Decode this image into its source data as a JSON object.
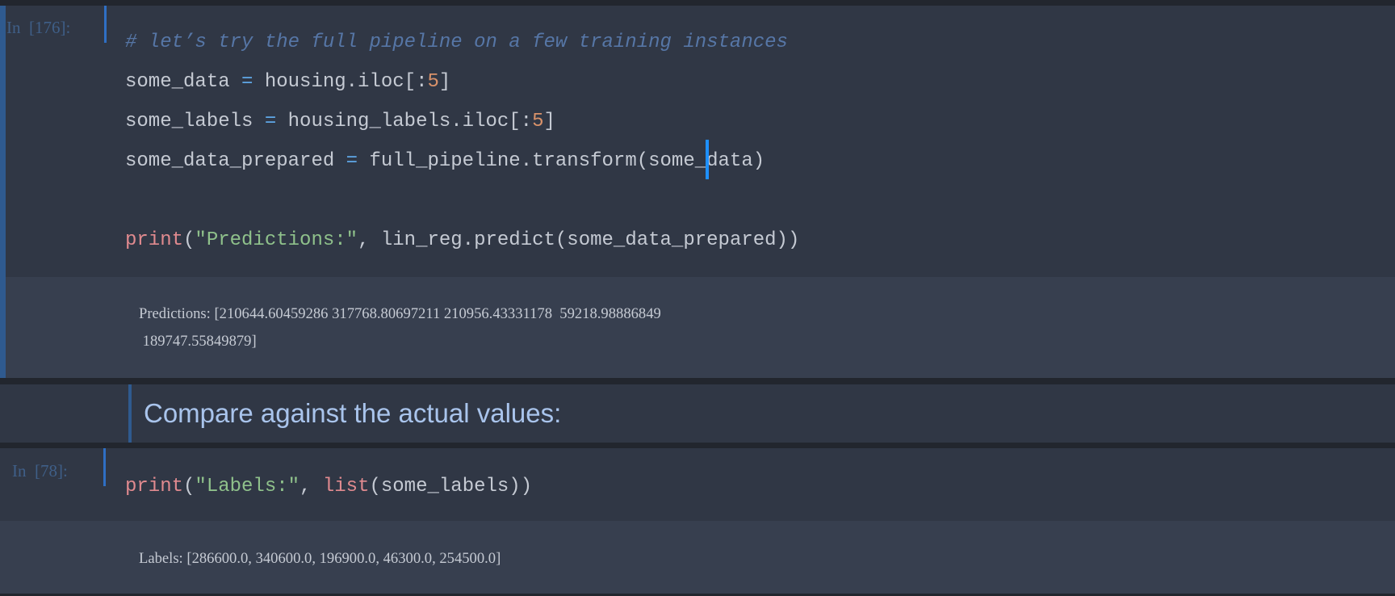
{
  "colors": {
    "accent": "#2f6fc4",
    "selected_bar": "#2f5a8f",
    "cursor": "#1e90ff"
  },
  "cells": [
    {
      "prompt": "In  [176]:",
      "code": [
        [
          {
            "t": "# let’s try the full pipeline on a few training instances",
            "c": "comment"
          }
        ],
        [
          {
            "t": "some_data ",
            "c": "plain"
          },
          {
            "t": "=",
            "c": "op"
          },
          {
            "t": " housing.iloc[:",
            "c": "plain"
          },
          {
            "t": "5",
            "c": "num"
          },
          {
            "t": "]",
            "c": "plain"
          }
        ],
        [
          {
            "t": "some_labels ",
            "c": "plain"
          },
          {
            "t": "=",
            "c": "op"
          },
          {
            "t": " housing_labels.iloc[:",
            "c": "plain"
          },
          {
            "t": "5",
            "c": "num"
          },
          {
            "t": "]",
            "c": "plain"
          }
        ],
        [
          {
            "t": "some_data_prepared ",
            "c": "plain"
          },
          {
            "t": "=",
            "c": "op"
          },
          {
            "t": " full_pipeline.transform(some_data)",
            "c": "plain"
          }
        ],
        [],
        [
          {
            "t": "print",
            "c": "builtin"
          },
          {
            "t": "(",
            "c": "plain"
          },
          {
            "t": "\"Predictions:\"",
            "c": "str"
          },
          {
            "t": ", lin_reg.predict(some_data_prepared))",
            "c": "plain"
          }
        ]
      ],
      "output": [
        "Predictions: [210644.60459286 317768.80697211 210956.43331178  59218.98886849",
        " 189747.55849879]"
      ]
    },
    {
      "markdown": "Compare against the actual values:"
    },
    {
      "prompt": "In  [78]:",
      "code": [
        [
          {
            "t": "print",
            "c": "builtin"
          },
          {
            "t": "(",
            "c": "plain"
          },
          {
            "t": "\"Labels:\"",
            "c": "str"
          },
          {
            "t": ", ",
            "c": "plain"
          },
          {
            "t": "list",
            "c": "builtin"
          },
          {
            "t": "(some_labels))",
            "c": "plain"
          }
        ]
      ],
      "output": [
        "Labels: [286600.0, 340600.0, 196900.0, 46300.0, 254500.0]"
      ]
    }
  ]
}
